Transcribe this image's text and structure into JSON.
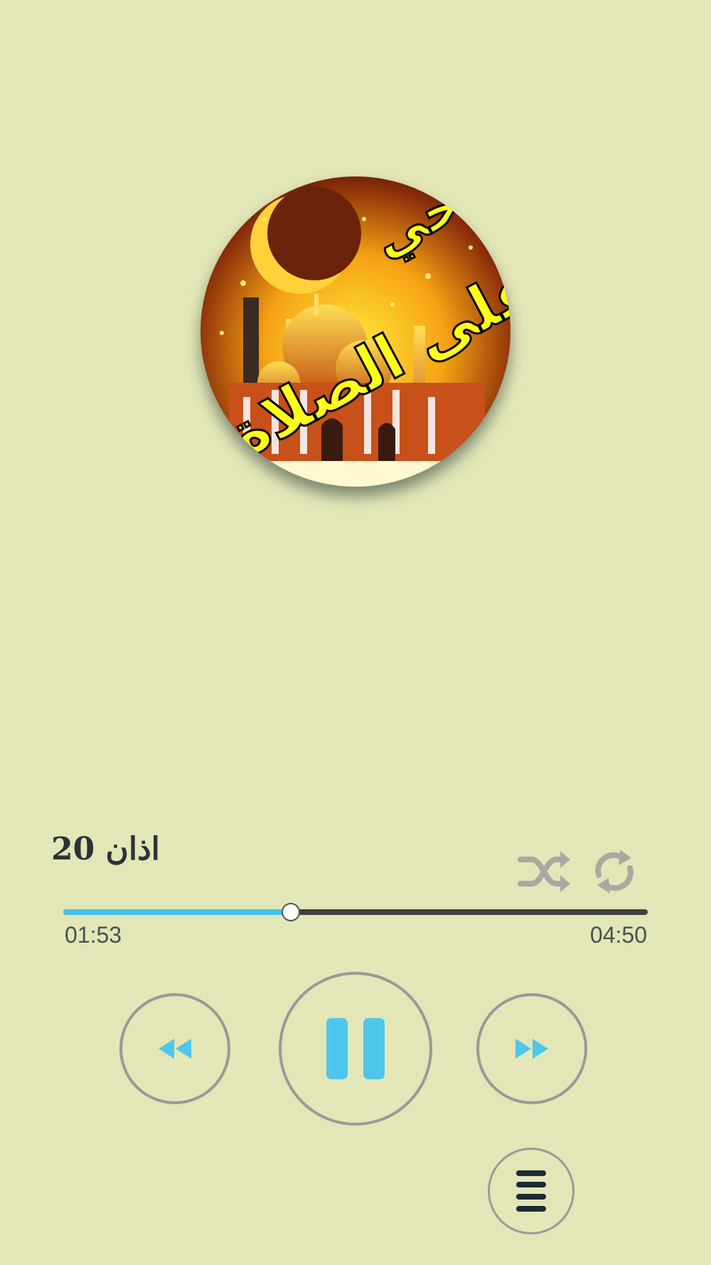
{
  "artwork": {
    "line1": "حي",
    "line2": "على الصلاة"
  },
  "track": {
    "title": "اذان 20",
    "elapsed": "01:53",
    "duration": "04:50",
    "progress": 0.389
  },
  "controls": {
    "shuffle_icon": "shuffle-icon",
    "repeat_icon": "repeat-icon",
    "rewind_icon": "rewind-icon",
    "pause_icon": "pause-icon",
    "forward_icon": "fast-forward-icon",
    "menu_icon": "menu-icon"
  },
  "colors": {
    "background": "#e3e6b6",
    "accent": "#45c3ea",
    "track": "#3f3f3f",
    "disabled": "#aaa9a0"
  }
}
